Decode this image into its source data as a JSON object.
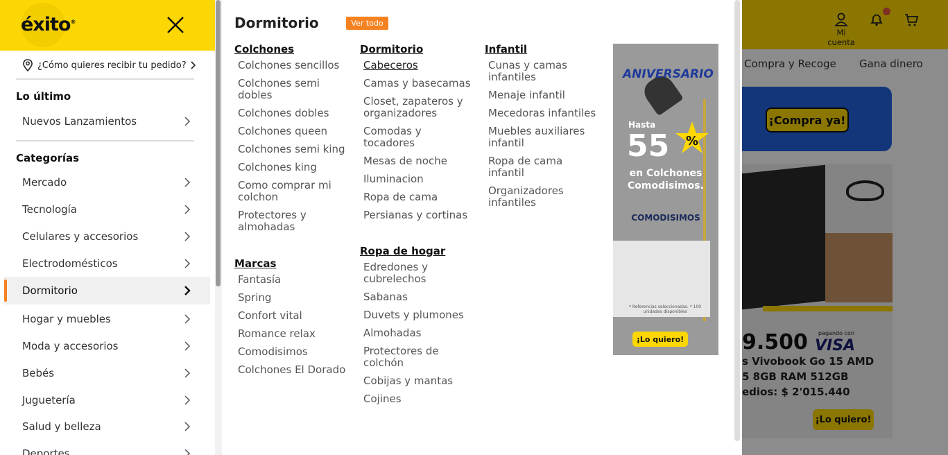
{
  "header": {
    "account_label": "Mi cuenta"
  },
  "nav": [
    "Compra y Recoge",
    "Gana dinero"
  ],
  "banner_top": {
    "button": "¡Compra ya!"
  },
  "product_banner": {
    "price": "9.500",
    "visa_pre": "pagando con",
    "visa": "VISA",
    "line1": "s Vivobook Go 15 AMD",
    "line2": "5 8GB RAM 512GB",
    "line3": "edios: $ 2'015.440",
    "button": "¡Lo quiero!"
  },
  "sidebar": {
    "logo": "éxito",
    "delivery": "¿Cómo quieres recibir tu pedido?",
    "section_latest": "Lo último",
    "latest_items": [
      {
        "label": "Nuevos Lanzamientos"
      }
    ],
    "section_categories": "Categorías",
    "categories": [
      {
        "label": "Mercado"
      },
      {
        "label": "Tecnología"
      },
      {
        "label": "Celulares y accesorios"
      },
      {
        "label": "Electrodomésticos"
      },
      {
        "label": "Dormitorio",
        "active": true
      },
      {
        "label": "Hogar y muebles"
      },
      {
        "label": "Moda y accesorios"
      },
      {
        "label": "Bebés"
      },
      {
        "label": "Juguetería"
      },
      {
        "label": "Salud y belleza"
      },
      {
        "label": "Deportes"
      }
    ]
  },
  "mega": {
    "title": "Dormitorio",
    "view_all": "Ver todo",
    "columns": [
      {
        "groups": [
          {
            "title": "Colchones",
            "links": [
              "Colchones sencillos",
              "Colchones semi dobles",
              "Colchones dobles",
              "Colchones queen",
              "Colchones semi king",
              "Colchones king",
              "Como comprar mi colchon",
              "Protectores y almohadas"
            ]
          },
          {
            "title": "Marcas",
            "links": [
              "Fantasía",
              "Spring",
              "Confort vital",
              "Romance relax",
              "Comodisimos",
              "Colchones El Dorado"
            ]
          }
        ]
      },
      {
        "groups": [
          {
            "title": "Dormitorio",
            "links": [
              "Cabeceros",
              "Camas y basecamas",
              "Closet, zapateros y organizadores",
              "Comodas y tocadores",
              "Mesas de noche",
              "Iluminacion",
              "Ropa de cama",
              "Persianas y cortinas"
            ]
          },
          {
            "title": "Ropa de hogar",
            "links": [
              "Edredones y cubrelechos",
              "Sabanas",
              "Duvets y plumones",
              "Almohadas",
              "Protectores de colchón",
              "Cobijas y mantas",
              "Cojines"
            ]
          }
        ]
      },
      {
        "groups": [
          {
            "title": "Infantil",
            "links": [
              "Cunas y camas infantiles",
              "Menaje infantil",
              "Mecedoras infantiles",
              "Muebles auxiliares infantil",
              "Ropa de cama infantil",
              "Organizadores infantiles"
            ]
          }
        ]
      }
    ],
    "promo": {
      "title": "ANIVERSARIO",
      "hasta": "Hasta",
      "percent": "55",
      "percent_sign": "%",
      "line1": "en Colchones",
      "line2": "Comodisimos.",
      "brand": "COMODISIMOS",
      "fine_print": "* Referencias seleccionadas. * 100 unidades disponibles",
      "button": "¡Lo quiero!"
    }
  },
  "colors": {
    "brand_yellow": "#fcd703",
    "accent_orange": "#f58220"
  }
}
